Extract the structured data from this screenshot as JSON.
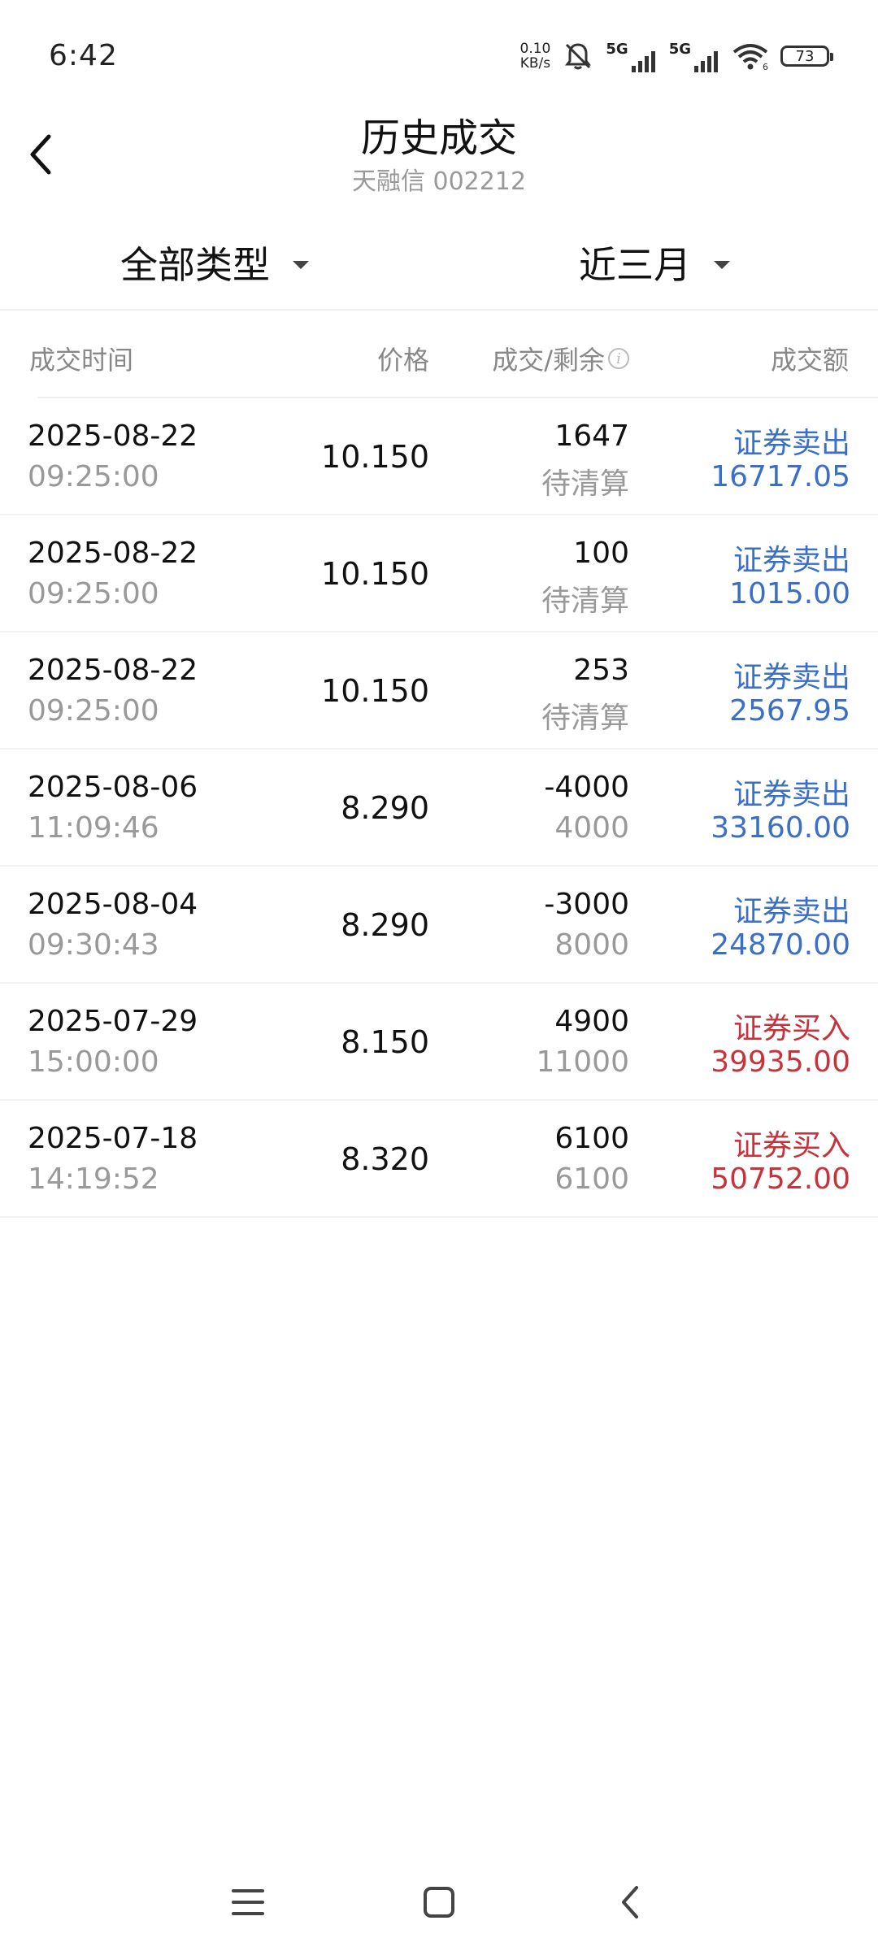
{
  "status_bar": {
    "time": "6:42",
    "net_speed_value": "0.10",
    "net_speed_unit": "KB/s",
    "sim1_label": "5G",
    "sim2_label": "5G",
    "wifi_sub": "6",
    "battery": "73"
  },
  "header": {
    "title": "历史成交",
    "subtitle": "天融信 002212"
  },
  "filters": {
    "type_label": "全部类型",
    "range_label": "近三月"
  },
  "table": {
    "columns": {
      "time": "成交时间",
      "price": "价格",
      "qty": "成交/剩余",
      "amount": "成交额"
    },
    "rows": [
      {
        "date": "2025-08-22",
        "time": "09:25:00",
        "price": "10.150",
        "qty": "1647",
        "remain": "待清算",
        "type": "证券卖出",
        "amount": "16717.05",
        "side": "sell"
      },
      {
        "date": "2025-08-22",
        "time": "09:25:00",
        "price": "10.150",
        "qty": "100",
        "remain": "待清算",
        "type": "证券卖出",
        "amount": "1015.00",
        "side": "sell"
      },
      {
        "date": "2025-08-22",
        "time": "09:25:00",
        "price": "10.150",
        "qty": "253",
        "remain": "待清算",
        "type": "证券卖出",
        "amount": "2567.95",
        "side": "sell"
      },
      {
        "date": "2025-08-06",
        "time": "11:09:46",
        "price": "8.290",
        "qty": "-4000",
        "remain": "4000",
        "type": "证券卖出",
        "amount": "33160.00",
        "side": "sell"
      },
      {
        "date": "2025-08-04",
        "time": "09:30:43",
        "price": "8.290",
        "qty": "-3000",
        "remain": "8000",
        "type": "证券卖出",
        "amount": "24870.00",
        "side": "sell"
      },
      {
        "date": "2025-07-29",
        "time": "15:00:00",
        "price": "8.150",
        "qty": "4900",
        "remain": "11000",
        "type": "证券买入",
        "amount": "39935.00",
        "side": "buy"
      },
      {
        "date": "2025-07-18",
        "time": "14:19:52",
        "price": "8.320",
        "qty": "6100",
        "remain": "6100",
        "type": "证券买入",
        "amount": "50752.00",
        "side": "buy"
      }
    ]
  },
  "colors": {
    "sell": "#3a6fc7",
    "buy": "#c8333b"
  }
}
